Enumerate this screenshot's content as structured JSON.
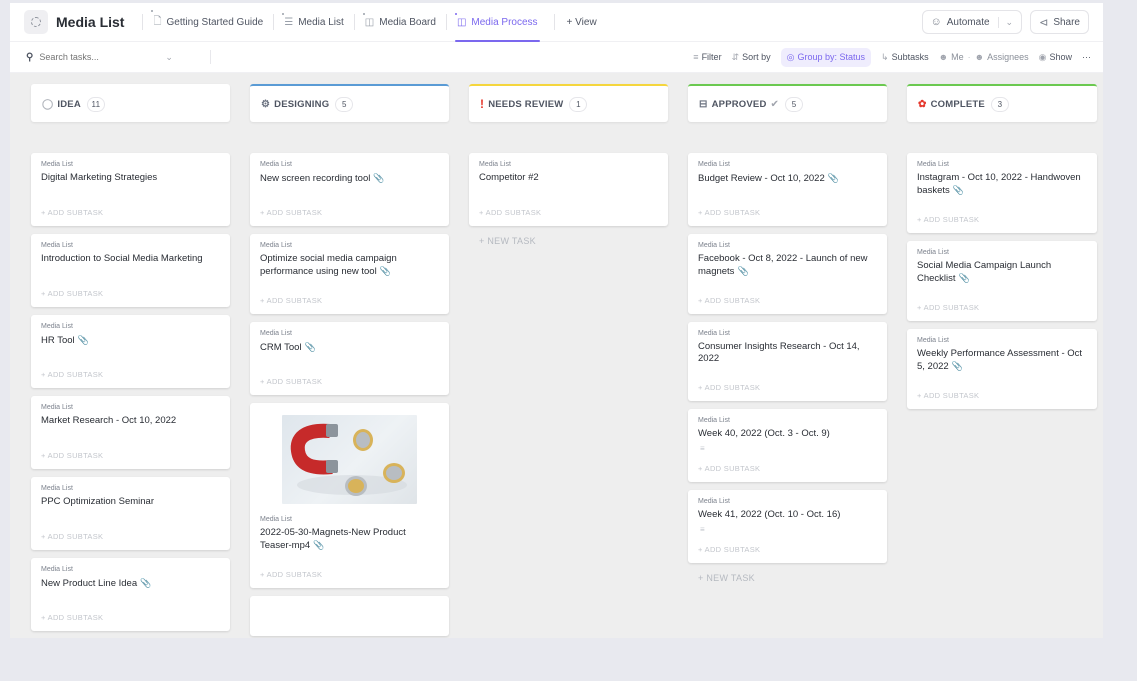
{
  "header": {
    "space_title": "Media List",
    "views": [
      {
        "label": "Getting Started Guide",
        "icon": "doc-icon",
        "active": false
      },
      {
        "label": "Media List",
        "icon": "list-icon",
        "active": false
      },
      {
        "label": "Media Board",
        "icon": "board-icon",
        "active": false
      },
      {
        "label": "Media Process",
        "icon": "board-icon",
        "active": true
      }
    ],
    "add_view_label": "+ View",
    "automate_label": "Automate",
    "share_label": "Share"
  },
  "toolbar": {
    "search_placeholder": "Search tasks...",
    "filter_label": "Filter",
    "sort_label": "Sort by",
    "group_label": "Group by: Status",
    "subtasks_label": "Subtasks",
    "me_label": "Me",
    "assignees_label": "Assignees",
    "show_label": "Show",
    "more_label": "···"
  },
  "accent_color": "#7b68ee",
  "columns": [
    {
      "name": "IDEA",
      "count": "11",
      "color": "#d3d3d3",
      "icon": "dashed-circle-icon",
      "cards": [
        {
          "list": "Media List",
          "title": "Digital Marketing Strategies",
          "attachment": false
        },
        {
          "list": "Media List",
          "title": "Introduction to Social Media Marketing",
          "attachment": false
        },
        {
          "list": "Media List",
          "title": "HR Tool",
          "attachment": true
        },
        {
          "list": "Media List",
          "title": "Market Research - Oct 10, 2022",
          "attachment": false
        },
        {
          "list": "Media List",
          "title": "PPC Optimization Seminar",
          "attachment": false
        },
        {
          "list": "Media List",
          "title": "New Product Line Idea",
          "attachment": true
        }
      ]
    },
    {
      "name": "DESIGNING",
      "count": "5",
      "color": "#5a9bd5",
      "icon": "gear-icon",
      "cards": [
        {
          "list": "Media List",
          "title": "New screen recording tool",
          "attachment": true
        },
        {
          "list": "Media List",
          "title": "Optimize social media campaign performance using new tool",
          "attachment": true
        },
        {
          "list": "Media List",
          "title": "CRM Tool",
          "attachment": true
        },
        {
          "list": "Media List",
          "title": "2022-05-30-Magnets-New Product Teaser-mp4",
          "attachment": true,
          "image": "magnet-and-coins-image"
        }
      ]
    },
    {
      "name": "NEEDS REVIEW",
      "count": "1",
      "color": "#f5d63d",
      "icon": "exclamation-icon",
      "cards": [
        {
          "list": "Media List",
          "title": "Competitor #2",
          "attachment": false
        }
      ],
      "new_task_label": "+ NEW TASK"
    },
    {
      "name": "APPROVED",
      "count": "5",
      "color": "#6bc950",
      "icon": "approved-box-icon",
      "cards": [
        {
          "list": "Media List",
          "title": "Budget Review - Oct 10, 2022",
          "attachment": true
        },
        {
          "list": "Media List",
          "title": "Facebook - Oct 8, 2022 - Launch of new magnets",
          "attachment": true
        },
        {
          "list": "Media List",
          "title": "Consumer Insights Research - Oct 14, 2022",
          "attachment": false
        },
        {
          "list": "Media List",
          "title": "Week 40, 2022 (Oct. 3 - Oct. 9)",
          "attachment": false,
          "description": true
        },
        {
          "list": "Media List",
          "title": "Week 41, 2022 (Oct. 10 - Oct. 16)",
          "attachment": false,
          "description": true
        }
      ],
      "new_task_label": "+ NEW TASK"
    },
    {
      "name": "COMPLETE",
      "count": "3",
      "color": "#6bc950",
      "icon": "celebration-icon",
      "cards": [
        {
          "list": "Media List",
          "title": "Instagram - Oct 10, 2022 - Handwoven baskets",
          "attachment": true
        },
        {
          "list": "Media List",
          "title": "Social Media Campaign Launch Checklist",
          "attachment": true
        },
        {
          "list": "Media List",
          "title": "Weekly Performance Assessment - Oct 5, 2022",
          "attachment": true
        }
      ]
    }
  ],
  "add_subtask_label": "+ ADD SUBTASK"
}
